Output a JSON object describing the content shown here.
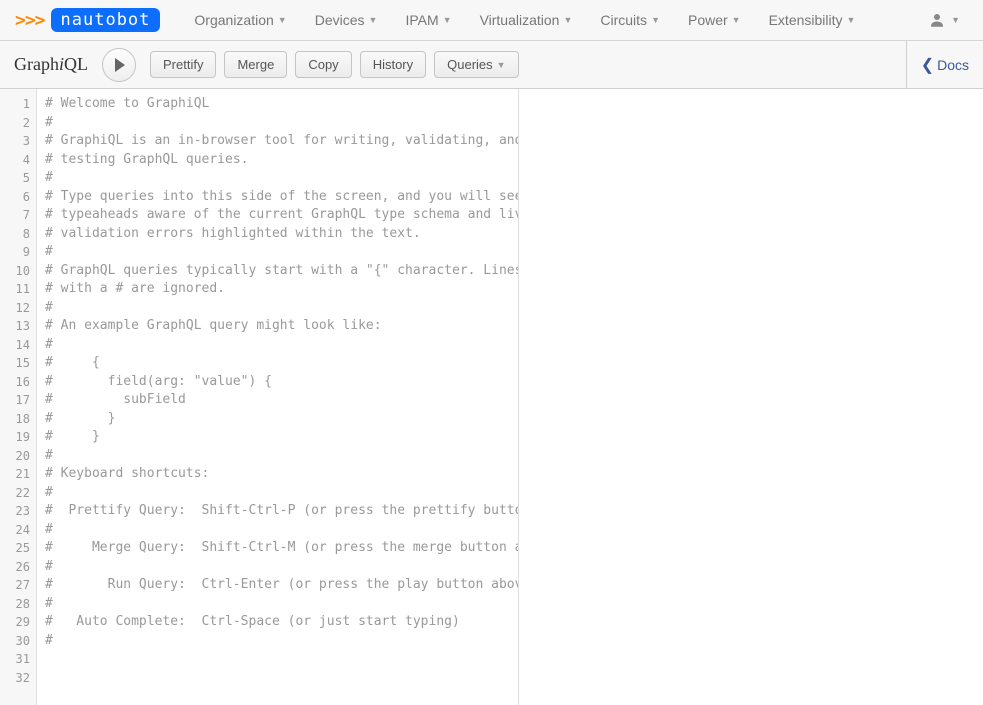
{
  "brand": {
    "prompt": ">>>",
    "name": "nautobot"
  },
  "nav": {
    "items": [
      {
        "label": "Organization"
      },
      {
        "label": "Devices"
      },
      {
        "label": "IPAM"
      },
      {
        "label": "Virtualization"
      },
      {
        "label": "Circuits"
      },
      {
        "label": "Power"
      },
      {
        "label": "Extensibility"
      }
    ]
  },
  "graphiql": {
    "title_pre": "Graph",
    "title_i": "i",
    "title_post": "QL",
    "buttons": {
      "prettify": "Prettify",
      "merge": "Merge",
      "copy": "Copy",
      "history": "History",
      "queries": "Queries"
    },
    "docs": "Docs"
  },
  "editor": {
    "lines": [
      "# Welcome to GraphiQL",
      "#",
      "# GraphiQL is an in-browser tool for writing, validating, and",
      "# testing GraphQL queries.",
      "#",
      "# Type queries into this side of the screen, and you will see",
      "# typeaheads aware of the current GraphQL type schema and live",
      "# validation errors highlighted within the text.",
      "#",
      "# GraphQL queries typically start with a \"{\" character. Lines",
      "# with a # are ignored.",
      "#",
      "# An example GraphQL query might look like:",
      "#",
      "#     {",
      "#       field(arg: \"value\") {",
      "#         subField",
      "#       }",
      "#     }",
      "#",
      "# Keyboard shortcuts:",
      "#",
      "#  Prettify Query:  Shift-Ctrl-P (or press the prettify button",
      "#",
      "#     Merge Query:  Shift-Ctrl-M (or press the merge button ab",
      "#",
      "#       Run Query:  Ctrl-Enter (or press the play button above",
      "#",
      "#   Auto Complete:  Ctrl-Space (or just start typing)",
      "#",
      "",
      ""
    ]
  }
}
